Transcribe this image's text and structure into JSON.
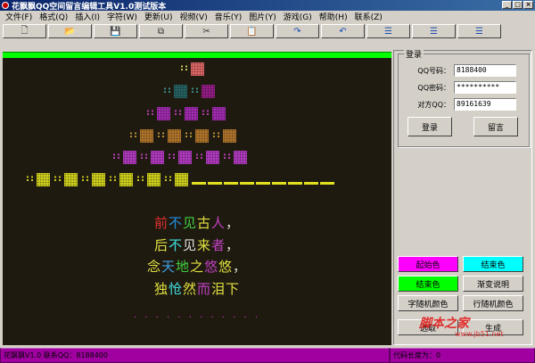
{
  "window": {
    "title": "花飘飘QQ空间留言编辑工具V1.0测试版本",
    "controls": [
      "_",
      "□",
      "×"
    ]
  },
  "menu": [
    "文件(F)",
    "格式(Q)",
    "插入(I)",
    "字符(W)",
    "更新(U)",
    "视频(V)",
    "音乐(Y)",
    "图片(Y)",
    "游戏(G)",
    "帮助(H)",
    "联系(Z)"
  ],
  "toolbar": [
    {
      "name": "new-icon",
      "glyph": "🗋"
    },
    {
      "name": "open-icon",
      "glyph": "📂"
    },
    {
      "name": "save-icon",
      "glyph": "💾"
    },
    {
      "name": "copy-icon",
      "glyph": "⧉"
    },
    {
      "name": "cut-icon",
      "glyph": "✂"
    },
    {
      "name": "paste-icon",
      "glyph": "📋"
    },
    {
      "name": "redo-icon",
      "glyph": "↷"
    },
    {
      "name": "undo-icon",
      "glyph": "↶"
    },
    {
      "name": "align-left-icon",
      "glyph": "☰"
    },
    {
      "name": "align-center-icon",
      "glyph": "☰"
    },
    {
      "name": "align-right-icon",
      "glyph": "☰"
    }
  ],
  "editor": {
    "background": "#1f1a10",
    "pyramid": [
      {
        "dots": "::",
        "dot_color": "#e0e060",
        "cells": [
          "#f07070"
        ]
      },
      {
        "dots": "::",
        "dot_color": "#40a0a0",
        "cells": [
          "#2a6a6a",
          "#a02090"
        ]
      },
      {
        "dots": "::",
        "dot_color": "#d040d0",
        "cells": [
          "#b030c0",
          "#b030c0",
          "#b030c0"
        ]
      },
      {
        "dots": "::",
        "dot_color": "#d0a040",
        "cells": [
          "#c08030",
          "#c08030",
          "#c08030",
          "#c08030"
        ]
      },
      {
        "dots": "::",
        "dot_color": "#d040d0",
        "cells": [
          "#c040d0",
          "#c040d0",
          "#c040d0",
          "#c040d0",
          "#c040d0"
        ]
      },
      {
        "dots": "::",
        "dot_color": "#e0e020",
        "cells": [
          "#e0e020",
          "#e0e020",
          "#e0e020",
          "#e0e020",
          "#e0e020",
          "#e0e020"
        ],
        "dashes": 9
      }
    ],
    "poem": [
      {
        "text": "前不见古人，",
        "colors": [
          "#e03030",
          "#2090e0",
          "#40d040",
          "#e0e040",
          "#c040c0",
          "#e0e0e0"
        ]
      },
      {
        "text": "后不见来者，",
        "colors": [
          "#e0e040",
          "#40e0e0",
          "#e0e0e0",
          "#e0e040",
          "#c040c0",
          "#e0e0e0"
        ]
      },
      {
        "text": "念天地之悠悠，",
        "colors": [
          "#e0e040",
          "#40a0e0",
          "#40d040",
          "#e0e040",
          "#c040c0",
          "#e0e040",
          "#e0e0e0"
        ]
      },
      {
        "text": "独怆然而泪下",
        "colors": [
          "#e0e040",
          "#40e0e0",
          "#e0e040",
          "#c040c0",
          "#e0e040",
          "#e0e040"
        ]
      }
    ],
    "trailing_dots": ". . . . . . . . . . . ."
  },
  "login": {
    "group_title": "登录",
    "qq_label": "QQ号码：",
    "qq_value": "8188400",
    "password_label": "QQ密码：",
    "password_value": "**********",
    "target_label": "对方QQ：",
    "target_value": "89161639",
    "login_button": "登录",
    "message_button": "留言"
  },
  "color_buttons": [
    {
      "label": "起始色",
      "bg": "#ff00ff"
    },
    {
      "label": "结束色",
      "bg": "#00ffff"
    },
    {
      "label": "结束色",
      "bg": "#00ff00"
    },
    {
      "label": "渐变说明",
      "bg": "#d4d0c8"
    },
    {
      "label": "字随机颜色",
      "bg": "#d4d0c8"
    },
    {
      "label": "行随机颜色",
      "bg": "#d4d0c8"
    },
    {
      "label": "选取",
      "bg": "#d4d0c8"
    },
    {
      "label": "生成",
      "bg": "#d4d0c8"
    }
  ],
  "status": {
    "left": "花飘飘V1.0 联系QQ：8188400",
    "right": "代码长度为：0"
  },
  "watermark": {
    "text": "脚本之家",
    "sub": "www.jb51.net"
  }
}
